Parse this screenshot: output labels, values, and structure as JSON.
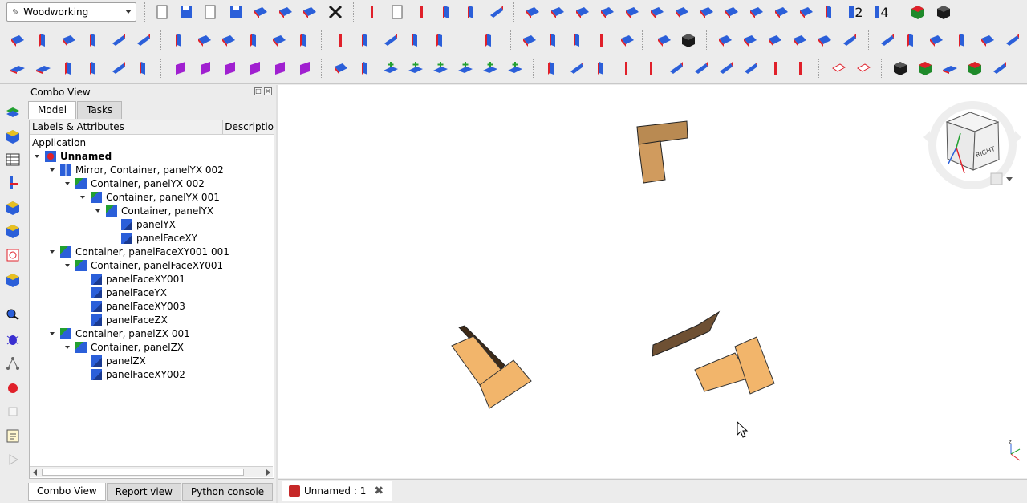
{
  "toolbar": {
    "workbench": "Woodworking",
    "label_2": "2",
    "label_4": "4"
  },
  "combo_view": {
    "title": "Combo View",
    "tabs": [
      {
        "label": "Model"
      },
      {
        "label": "Tasks"
      }
    ],
    "columns": {
      "labels": "Labels & Attributes",
      "description": "Descriptio"
    },
    "tree": [
      {
        "label": "Application",
        "level": 0,
        "bold": false
      },
      {
        "label": "Unnamed",
        "level": 1,
        "bold": true
      },
      {
        "label": "Mirror, Container, panelYX 002",
        "level": 2,
        "bold": false
      },
      {
        "label": "Container, panelYX 002",
        "level": 3,
        "bold": false
      },
      {
        "label": "Container, panelYX 001",
        "level": 4,
        "bold": false
      },
      {
        "label": "Container, panelYX",
        "level": 5,
        "bold": false
      },
      {
        "label": "panelYX",
        "level": 6,
        "bold": false
      },
      {
        "label": "panelFaceXY",
        "level": 6,
        "bold": false
      },
      {
        "label": "Container, panelFaceXY001 001",
        "level": 2,
        "bold": false
      },
      {
        "label": "Container, panelFaceXY001",
        "level": 3,
        "bold": false
      },
      {
        "label": "panelFaceXY001",
        "level": 4,
        "bold": false
      },
      {
        "label": "panelFaceYX",
        "level": 4,
        "bold": false
      },
      {
        "label": "panelFaceXY003",
        "level": 4,
        "bold": false
      },
      {
        "label": "panelFaceZX",
        "level": 4,
        "bold": false
      },
      {
        "label": "Container, panelZX 001",
        "level": 2,
        "bold": false
      },
      {
        "label": "Container, panelZX",
        "level": 3,
        "bold": false
      },
      {
        "label": "panelZX",
        "level": 4,
        "bold": false
      },
      {
        "label": "panelFaceXY002",
        "level": 4,
        "bold": false
      }
    ],
    "bottom_tabs": [
      {
        "label": "Combo View"
      },
      {
        "label": "Report view"
      },
      {
        "label": "Python console"
      }
    ]
  },
  "navcube": {
    "face_label": "RIGHT"
  },
  "document_tab": {
    "label": "Unnamed : 1"
  },
  "colors": {
    "wood_light": "#f2b56b",
    "wood_mid": "#c99558",
    "wood_dark": "#6e5033",
    "accent_blue": "#2b5fd9",
    "accent_red": "#e0202a"
  }
}
